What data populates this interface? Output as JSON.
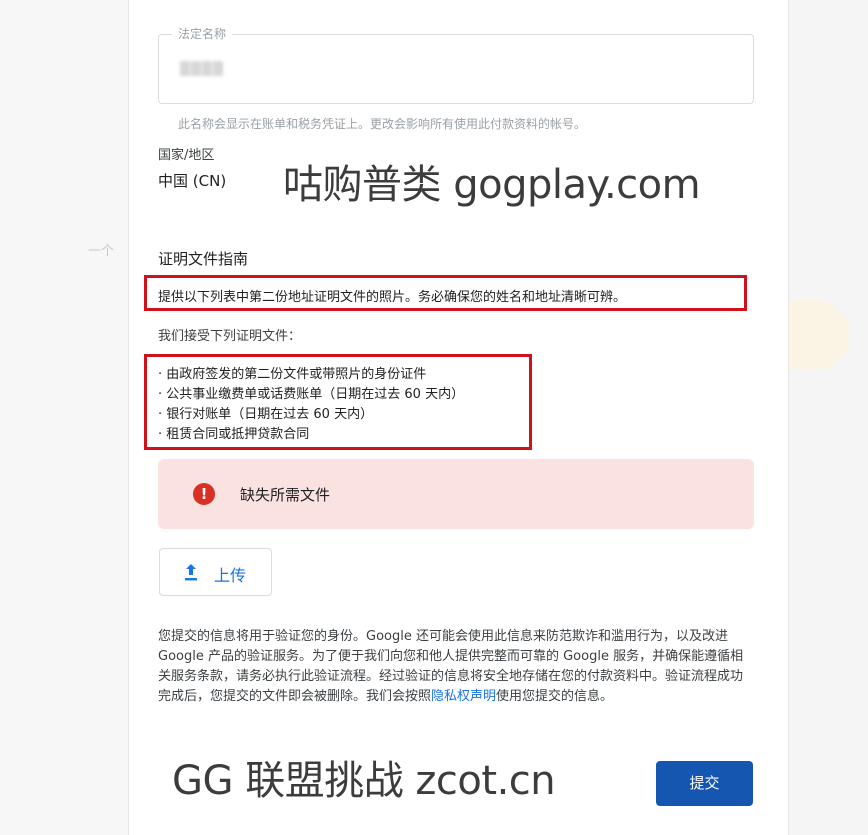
{
  "form": {
    "legal_name_label": "法定名称",
    "legal_name_value": "▒▒▒▒",
    "legal_name_helper": "此名称会显示在账单和税务凭证上。更改会影响所有使用此付款资料的帐号。",
    "country_label": "国家/地区",
    "country_value": "中国 (CN)"
  },
  "watermarks": {
    "top": "咕购普类 gogplay.com",
    "bottom": "GG 联盟挑战 zcot.cn"
  },
  "guide": {
    "title": "证明文件指南",
    "description": "提供以下列表中第二份地址证明文件的照片。务必确保您的姓名和地址清晰可辨。",
    "accept_label": "我们接受下列证明文件：",
    "documents": [
      "由政府签发的第二份文件或带照片的身份证件",
      "公共事业缴费单或话费账单（日期在过去 60 天内）",
      "银行对账单（日期在过去 60 天内）",
      "租赁合同或抵押贷款合同"
    ]
  },
  "alert": {
    "icon": "error-icon",
    "icon_glyph": "!",
    "text": "缺失所需文件",
    "color": "#d93025"
  },
  "upload": {
    "icon": "upload-icon",
    "label": "上传"
  },
  "privacy": {
    "text": "您提交的信息将用于验证您的身份。Google 还可能会使用此信息来防范欺诈和滥用行为，以及改进 Google 产品的验证服务。为了便于我们向您和他人提供完整而可靠的 Google 服务，并确保能遵循相关服务条款，请务必执行此验证流程。经过验证的信息将安全地存储在您的付款资料中。验证流程成功完成后，您提交的文件即会被删除。我们会按照",
    "link": "隐私权声明",
    "suffix": "使用您提交的信息。"
  },
  "submit": {
    "label": "提交",
    "color": "#1557b0"
  },
  "background": {
    "dash": "一个"
  }
}
